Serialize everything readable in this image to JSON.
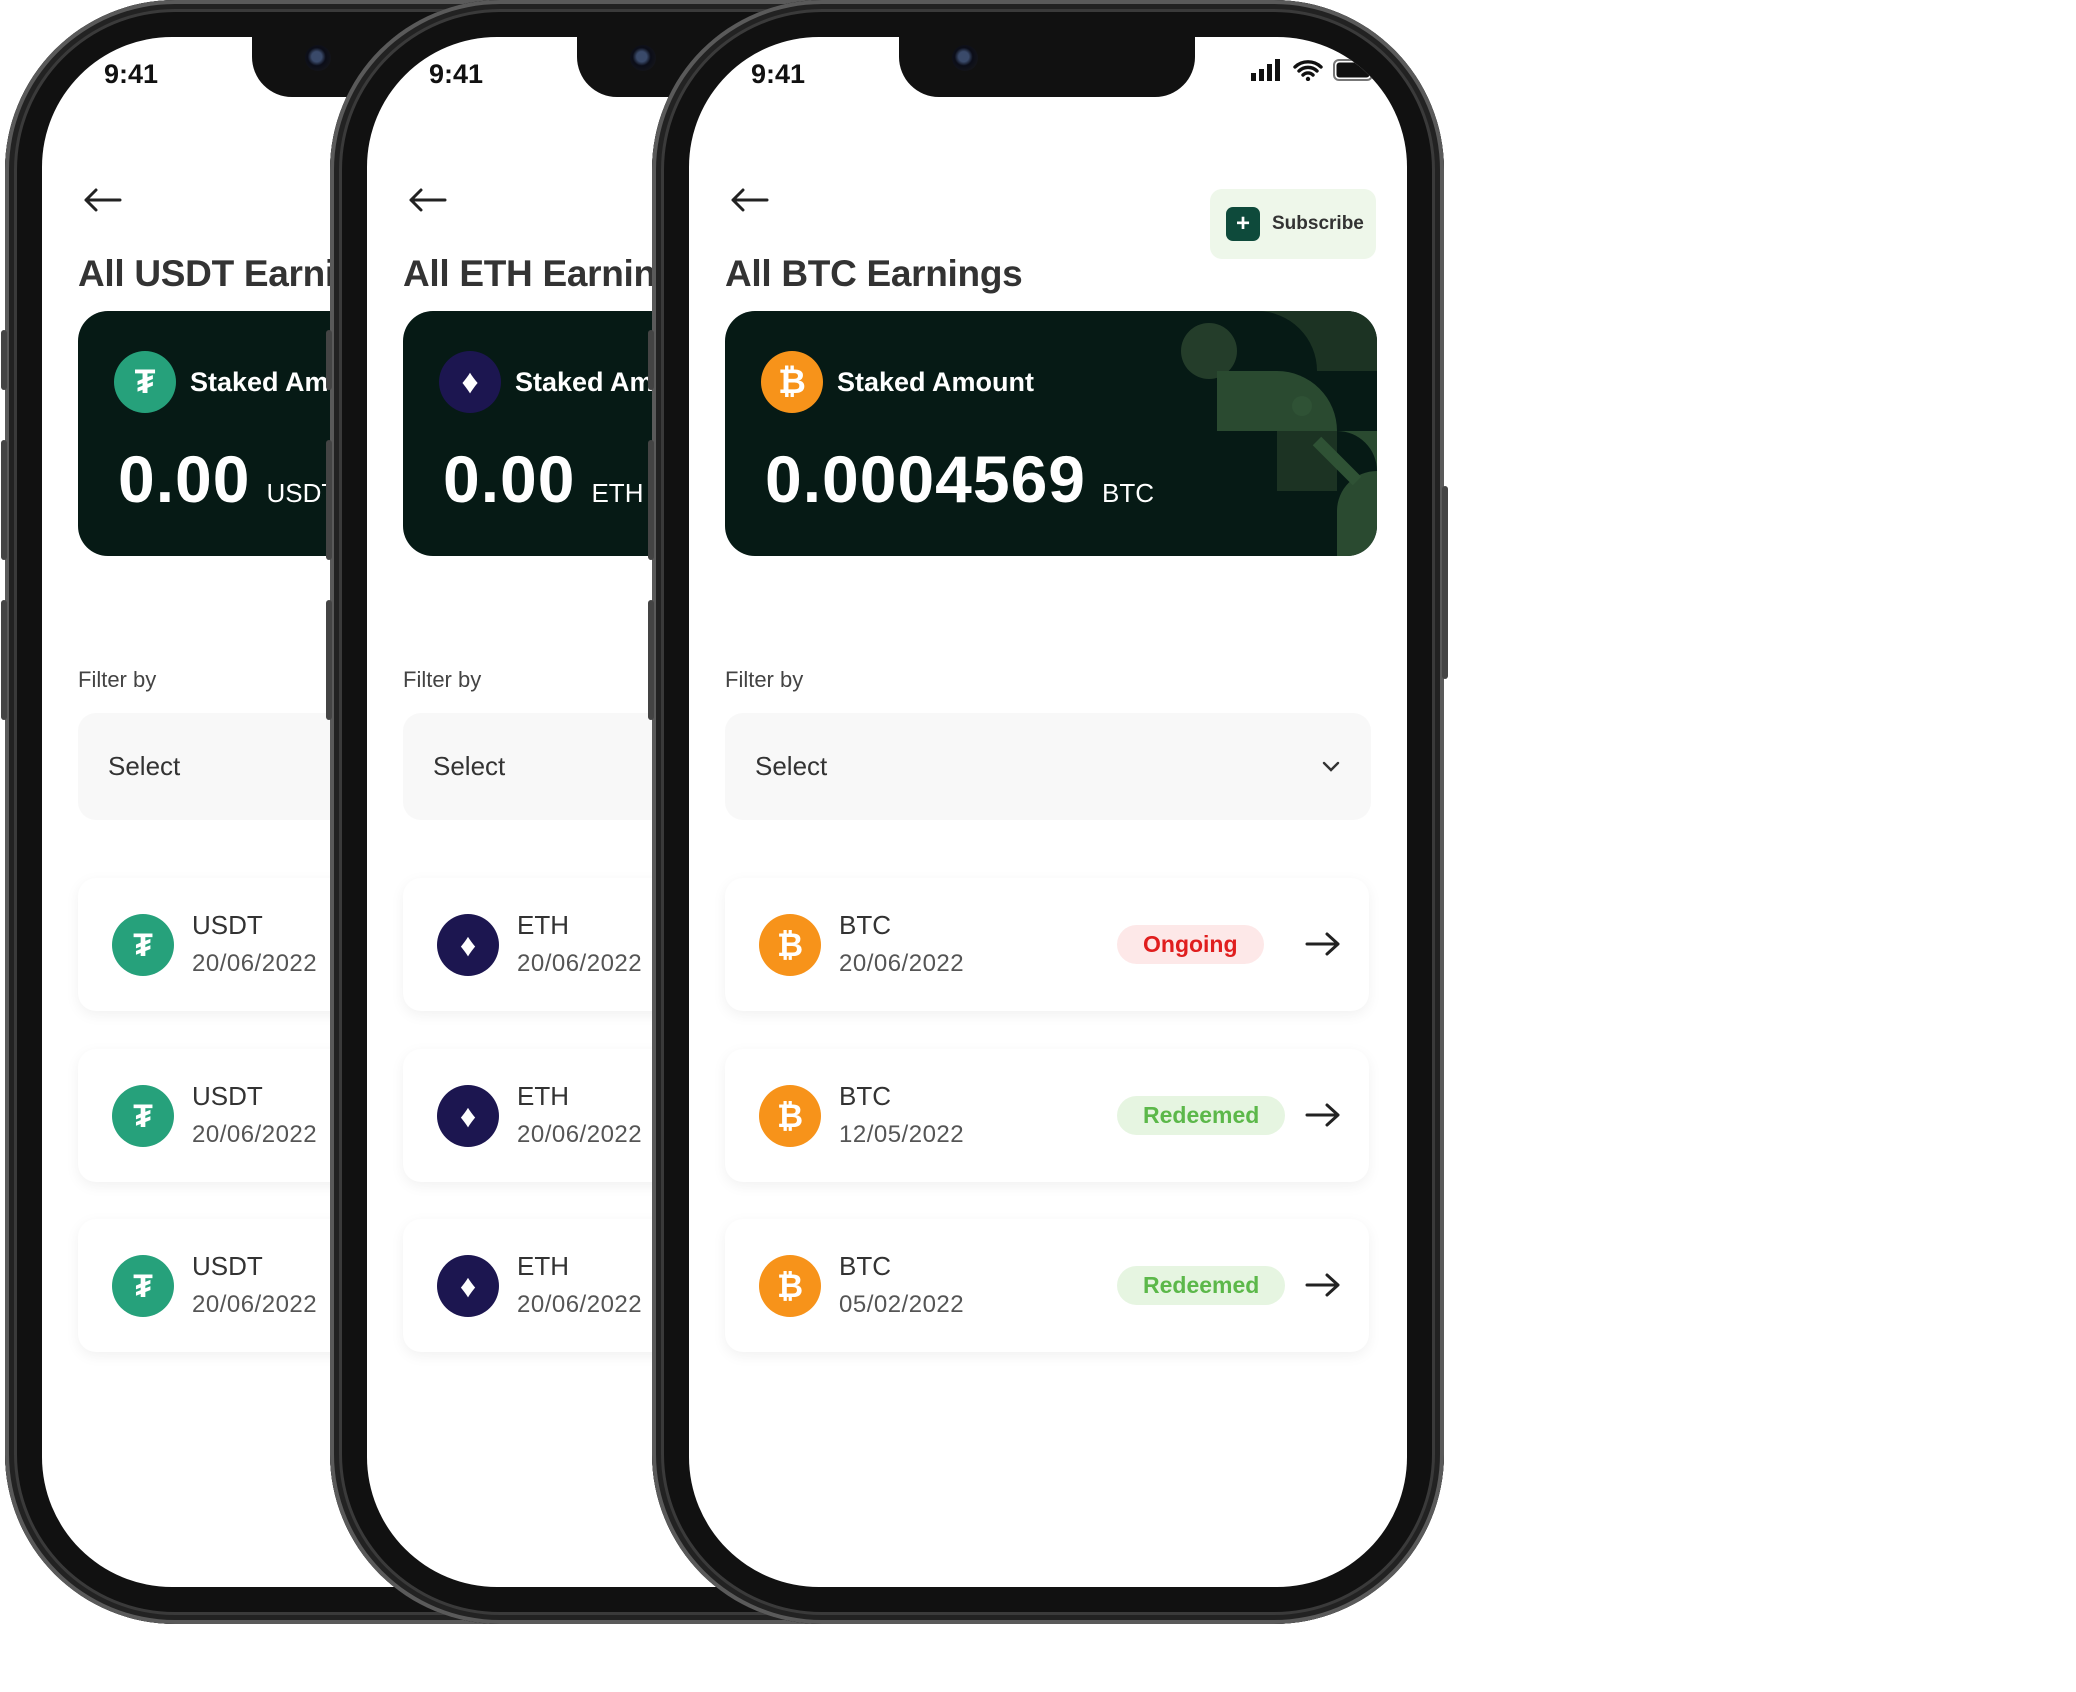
{
  "colors": {
    "usdt": "#26A17B",
    "eth": "#1c1650",
    "btc": "#F7931A",
    "card_bg": "#061a15",
    "ongoing_bg": "#fde8e8",
    "ongoing_fg": "#e01e1e",
    "redeemed_bg": "#e6f5e1",
    "redeemed_fg": "#5cb84a"
  },
  "phones": [
    {
      "time": "9:41",
      "title": "All USDT Earnings",
      "card": {
        "coin": "usdt",
        "coin_glyph": "₮",
        "label": "Staked Amount",
        "amount": "0.00",
        "unit": "USDT"
      },
      "filter": {
        "label": "Filter by",
        "value": "Select"
      },
      "items": [
        {
          "name": "USDT",
          "date": "20/06/2022"
        },
        {
          "name": "USDT",
          "date": "20/06/2022"
        },
        {
          "name": "USDT",
          "date": "20/06/2022"
        }
      ]
    },
    {
      "time": "9:41",
      "title": "All ETH Earnings",
      "card": {
        "coin": "eth",
        "coin_glyph": "♦",
        "label": "Staked Amount",
        "amount": "0.00",
        "unit": "ETH"
      },
      "filter": {
        "label": "Filter by",
        "value": "Select"
      },
      "items": [
        {
          "name": "ETH",
          "date": "20/06/2022"
        },
        {
          "name": "ETH",
          "date": "20/06/2022"
        },
        {
          "name": "ETH",
          "date": "20/06/2022"
        }
      ]
    },
    {
      "time": "9:41",
      "title": "All BTC Earnings",
      "subscribe_label": "Subscribe",
      "card": {
        "coin": "btc",
        "coin_glyph": "₿",
        "label": "Staked Amount",
        "amount": "0.0004569",
        "unit": "BTC"
      },
      "filter": {
        "label": "Filter by",
        "value": "Select"
      },
      "items": [
        {
          "name": "BTC",
          "date": "20/06/2022",
          "status": "Ongoing",
          "status_type": "ongoing"
        },
        {
          "name": "BTC",
          "date": "12/05/2022",
          "status": "Redeemed",
          "status_type": "redeemed"
        },
        {
          "name": "BTC",
          "date": "05/02/2022",
          "status": "Redeemed",
          "status_type": "redeemed"
        }
      ]
    }
  ]
}
